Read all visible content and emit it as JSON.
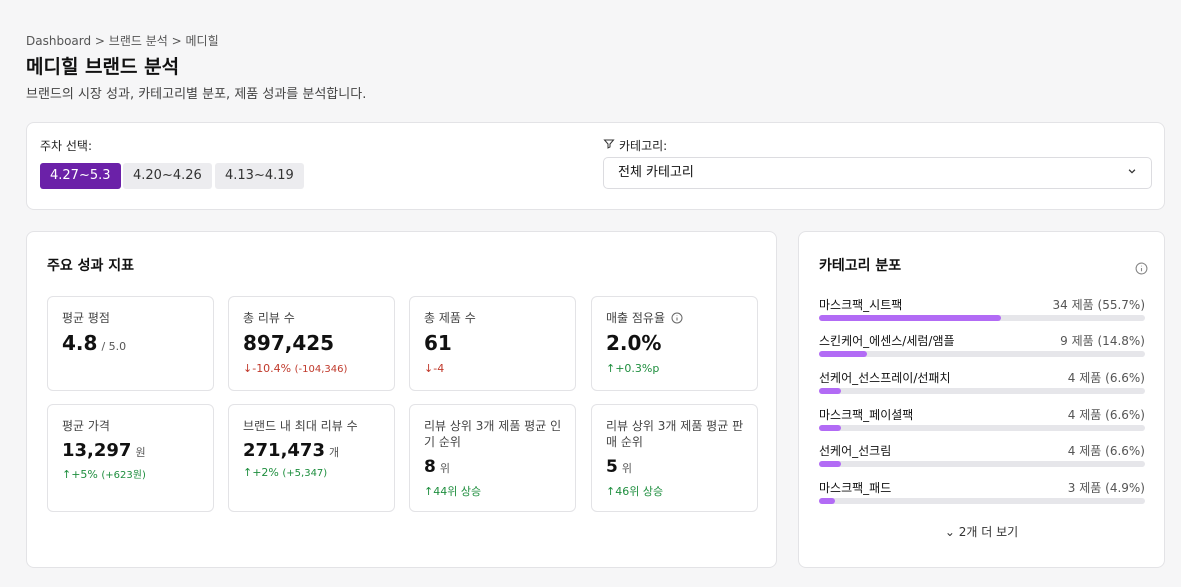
{
  "breadcrumb": "Dashboard > 브랜드 분석 > 메디힐",
  "title": "메디힐 브랜드 분석",
  "subtitle": "브랜드의 시장 성과, 카테고리별 분포, 제품 성과를 분석합니다.",
  "filters": {
    "week_label": "주차 선택:",
    "weeks": [
      "4.27~5.3",
      "4.20~4.26",
      "4.13~4.19"
    ],
    "selected_week_index": 0,
    "category_label": "카테고리:",
    "category_value": "전체 카테고리"
  },
  "kpi": {
    "title": "주요 성과 지표",
    "avg_rating": {
      "label": "평균 평점",
      "value": "4.8",
      "unit": "/ 5.0"
    },
    "total_reviews": {
      "label": "총 리뷰 수",
      "value": "897,425",
      "change": "-10.4%",
      "change_detail": "(-104,346)"
    },
    "total_products": {
      "label": "총 제품 수",
      "value": "61",
      "change": "-4"
    },
    "sales_share": {
      "label": "매출 점유율",
      "value": "2.0%",
      "change": "+0.3%p"
    },
    "avg_price": {
      "label": "평균 가격",
      "value": "13,297",
      "unit": "원",
      "change": "+5%",
      "change_detail": "(+623원)"
    },
    "max_reviews": {
      "label": "브랜드 내 최대 리뷰 수",
      "value": "271,473",
      "unit": "개",
      "change": "+2%",
      "change_detail": "(+5,347)"
    },
    "top3_popularity": {
      "label_line1": "리뷰 상위 3개 제품 평균 인",
      "label_line2": "기 순위",
      "value": "8",
      "unit": "위",
      "change": "44위 상승"
    },
    "top3_sales": {
      "label_line1": "리뷰 상위 3개 제품 평균 판",
      "label_line2": "매 순위",
      "value": "5",
      "unit": "위",
      "change": "46위 상승"
    }
  },
  "distribution": {
    "title": "카테고리 분포",
    "items": [
      {
        "name": "마스크팩_시트팩",
        "count": "34 제품 (55.7%)",
        "pct": 55.7
      },
      {
        "name": "스킨케어_에센스/세럼/앰플",
        "count": "9 제품 (14.8%)",
        "pct": 14.8
      },
      {
        "name": "선케어_선스프레이/선패치",
        "count": "4 제품 (6.6%)",
        "pct": 6.6
      },
      {
        "name": "마스크팩_페이셜팩",
        "count": "4 제품 (6.6%)",
        "pct": 6.6
      },
      {
        "name": "선케어_선크림",
        "count": "4 제품 (6.6%)",
        "pct": 6.6
      },
      {
        "name": "마스크팩_패드",
        "count": "3 제품 (4.9%)",
        "pct": 4.9
      }
    ],
    "more_label": "2개 더 보기"
  },
  "colors": {
    "accent": "#6b21a8",
    "bar": "#a855f7",
    "up": "#1e8e3e",
    "down": "#c0392b"
  }
}
